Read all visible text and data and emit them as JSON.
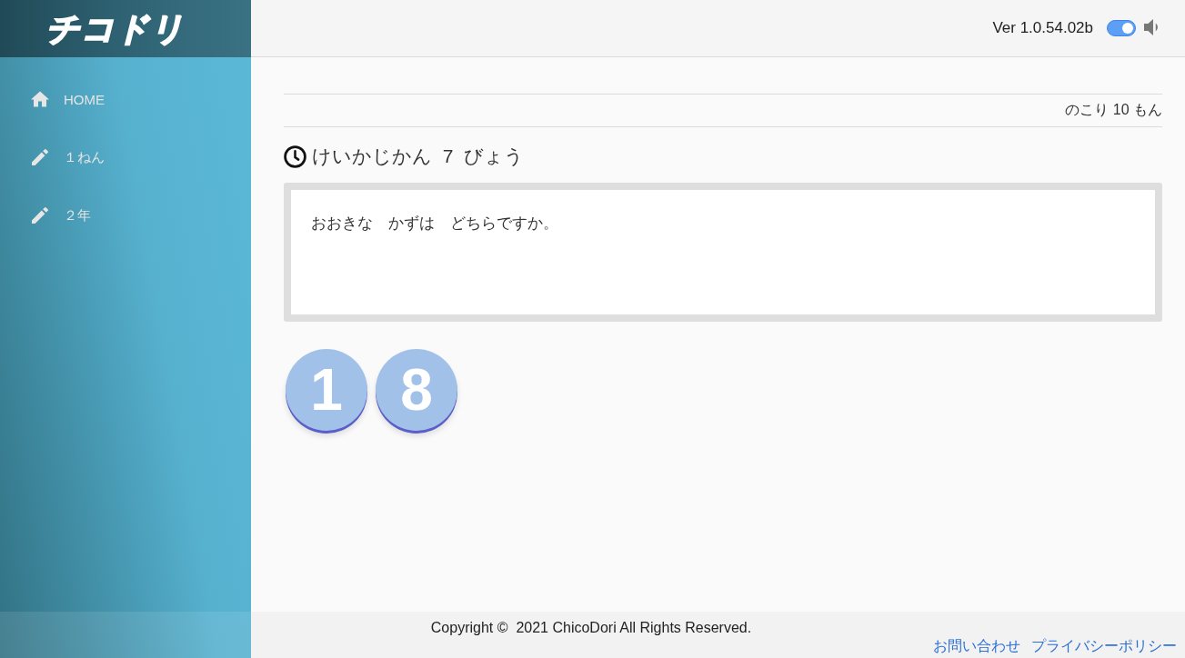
{
  "sidebar": {
    "logo": "チコドリ",
    "items": [
      {
        "kind": "home",
        "label": "HOME",
        "selected": false
      },
      {
        "kind": "pencil",
        "label": "１ねん",
        "selected": false
      },
      {
        "kind": "pencil",
        "label": "２年",
        "selected": false
      }
    ]
  },
  "header": {
    "version": "Ver 1.0.54.02b",
    "sound_toggle": {
      "on": true
    }
  },
  "quiz": {
    "remaining": "のこり 10 もん",
    "timer": "けいかじかん 7 びょう",
    "question": "おおきな　かずは　どちらですか。",
    "choices": [
      {
        "label": "1"
      },
      {
        "label": "8"
      }
    ]
  },
  "footer": {
    "copyright": "Copyright ©  2021 ChicoDori All Rights Reserved.",
    "links": [
      "お問い合わせ",
      "プライバシーポリシー"
    ]
  }
}
